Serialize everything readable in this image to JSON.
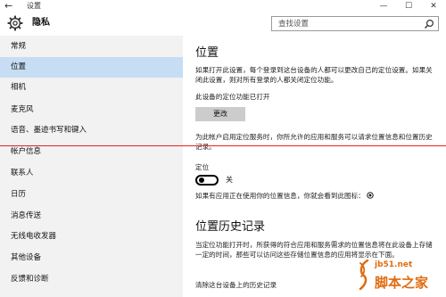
{
  "window": {
    "title": "设置",
    "back_glyph": "←",
    "minimize_glyph": "—",
    "maximize_glyph": "☐",
    "close_glyph": "✕"
  },
  "header": {
    "section_title": "隐私",
    "search_placeholder": "查找设置"
  },
  "sidebar": {
    "items": [
      {
        "label": "常规"
      },
      {
        "label": "位置",
        "selected": true
      },
      {
        "label": "相机"
      },
      {
        "label": "麦克风"
      },
      {
        "label": "语音、墨迹书写和键入"
      },
      {
        "label": "帐户信息"
      },
      {
        "label": "联系人"
      },
      {
        "label": "日历"
      },
      {
        "label": "消息传送"
      },
      {
        "label": "无线电收发器"
      },
      {
        "label": "其他设备"
      },
      {
        "label": "反馈和诊断"
      }
    ]
  },
  "content": {
    "location_title": "位置",
    "location_desc": "如果打开此设置，每个登录到这台设备的人都可以更改自己的定位设置。如果关闭此设置，则对所有登录的人都关闭定位功能。",
    "device_status": "此设备的定位功能已打开",
    "change_button": "更改",
    "account_desc": "为此帐户启用定位服务时，你所允许的应用和服务可以请求位置信息和位置历史记录。",
    "location_label": "定位",
    "toggle_state": "关",
    "icon_hint": "如果有应用正在使用你的位置信息，你就会看到此图标：",
    "history_title": "位置历史记录",
    "history_desc": "当定位功能打开时，所获得的符合应用和服务需求的位置信息将在此设备上存储一定的时间，那些可以访问这些存储位置信息的应用将显示在下面。",
    "clear_label": "清除这台设备上的历史记录"
  },
  "watermark": {
    "url": "jb51.net",
    "brand": "脚本之家"
  },
  "colors": {
    "selected_bg": "#c6ddf3",
    "sidebar_bg": "#f2f2f2",
    "annotation_line": "#e32020",
    "watermark": "#e06c10"
  }
}
